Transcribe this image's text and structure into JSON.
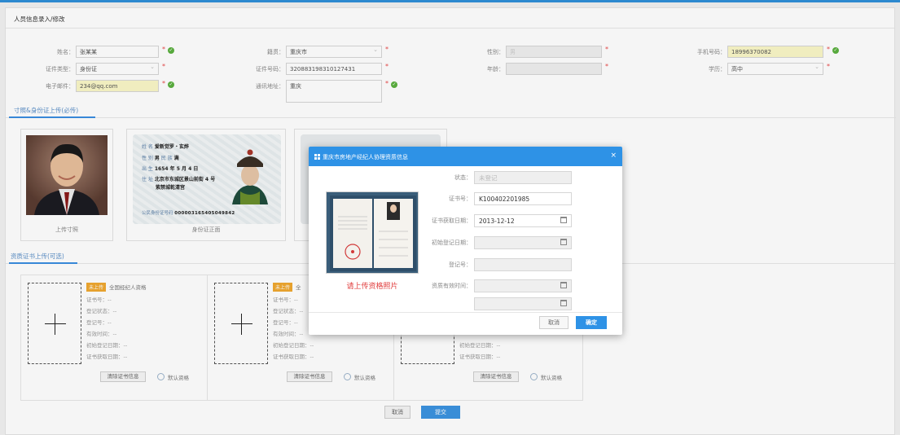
{
  "page_title": "人员信息录入/修改",
  "form": {
    "name": {
      "label": "姓名：",
      "value": "张某某"
    },
    "origin": {
      "label": "籍贯：",
      "value": "重庆市"
    },
    "gender": {
      "label": "性别：",
      "value": "男"
    },
    "phone": {
      "label": "手机号码：",
      "value": "18996370082"
    },
    "id_type": {
      "label": "证件类型：",
      "value": "身份证"
    },
    "id_number": {
      "label": "证件号码：",
      "value": "320883198310127431"
    },
    "age": {
      "label": "年龄：",
      "value": ""
    },
    "education": {
      "label": "学历：",
      "value": "高中"
    },
    "email": {
      "label": "电子邮件：",
      "value": "234@qq.com"
    },
    "address": {
      "label": "通讯地址：",
      "value": "重庆"
    },
    "required_mark": "*",
    "ok_mark": "✓"
  },
  "photo_section": {
    "title": "寸照&身份证上传(必传)",
    "photo_caption": "上传寸照",
    "id_front_caption": "身份证正面"
  },
  "id_card": {
    "name_label": "姓 名",
    "name_value": "爱新觉罗・玄烨",
    "gender_label": "性 别",
    "gender_value": "男",
    "ethnic_label": "民 族",
    "ethnic_value": "满",
    "birth_label": "出 生",
    "birth_value": "1654 年 5 月 4 日",
    "addr_label": "住 址",
    "addr_value_1": "北京市东城区景山前街 4 号",
    "addr_value_2": "紫禁城乾清宫",
    "number_label": "公民身份证号码",
    "number_value": "000003165405049842"
  },
  "cert_section": {
    "title": "资质证书上传(可选)",
    "cards": [
      {
        "tag": "未上传",
        "title": "全国经纪人资格"
      },
      {
        "tag": "未上传",
        "title": "全"
      },
      {
        "tag": "",
        "title": ""
      }
    ],
    "lines": [
      "证书号：--",
      "登记状态：--",
      "登记号：--",
      "有效时间：--",
      "初始登记日期：--",
      "证书获取日期：--"
    ],
    "clear_button": "清除证书信息",
    "default_label": "默认资格"
  },
  "footer": {
    "cancel": "取消",
    "submit": "提交"
  },
  "modal": {
    "title": "重庆市房地产经纪人协理资质信息",
    "close": "×",
    "photo_hint": "请上传资格照片",
    "fields": {
      "status": {
        "label": "状态：",
        "value": "未登记"
      },
      "cert_no": {
        "label": "证书号：",
        "value": "K100402201985"
      },
      "obtain_date": {
        "label": "证书获取日期：",
        "value": "2013-12-12"
      },
      "init_date": {
        "label": "初始登记日期：",
        "value": ""
      },
      "reg_no": {
        "label": "登记号：",
        "value": ""
      },
      "valid_time": {
        "label": "资质有效时间：",
        "value": ""
      }
    },
    "cancel": "取消",
    "ok": "确定"
  },
  "colors": {
    "accent": "#2e92e6",
    "required": "#e84848",
    "ok": "#5bb03f",
    "tag": "#f0a830"
  }
}
